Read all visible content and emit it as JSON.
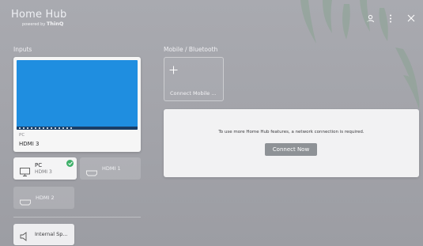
{
  "app": {
    "title": "Home Hub",
    "powered_by": "powered by",
    "brand": "ThinQ"
  },
  "header": {
    "icons": [
      "user-icon",
      "more-icon",
      "close-icon"
    ]
  },
  "inputs": {
    "section_label": "Inputs",
    "preview": {
      "type": "PC",
      "name": "HDMI 3"
    },
    "tiles": [
      {
        "label": "PC",
        "sub": "HDMI 3",
        "icon": "pc-icon",
        "selected": true
      },
      {
        "label": "HDMI 1",
        "icon": "hdmi-icon"
      },
      {
        "label": "HDMI 2",
        "icon": "hdmi-icon"
      }
    ],
    "speaker": {
      "label": "Internal Sp...",
      "icon": "speaker-icon"
    }
  },
  "mobile": {
    "section_label": "Mobile / Bluetooth",
    "connect_label": "Connect Mobile ..."
  },
  "network": {
    "message": "To use more Home Hub features, a network connection is required.",
    "button_label": "Connect Now"
  },
  "colors": {
    "background": "#a6a7ad",
    "screen_blue": "#1f8ee0",
    "check_green": "#3fb06a",
    "button_gray": "#8e9296"
  }
}
